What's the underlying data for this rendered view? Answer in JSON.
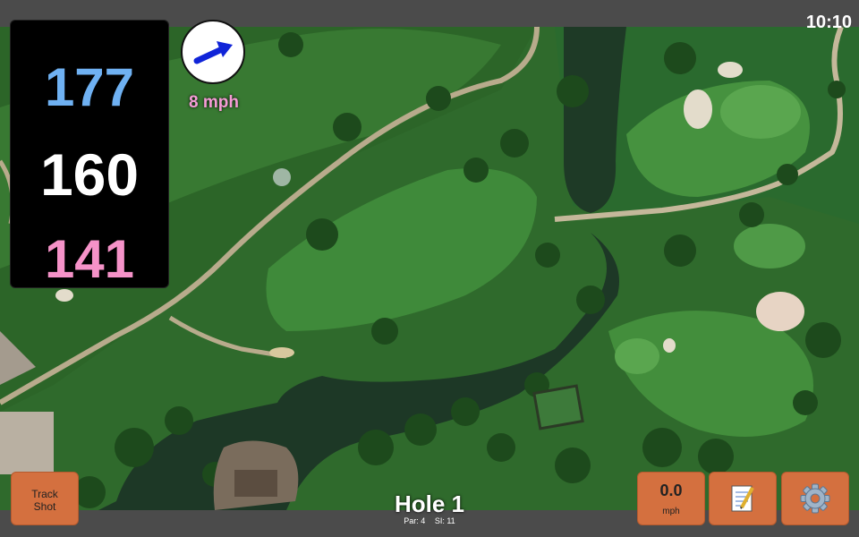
{
  "status_bar": {
    "time": "10:10"
  },
  "distances": {
    "back": "177",
    "middle": "160",
    "front": "141"
  },
  "wind": {
    "speed_label": "8 mph",
    "icon": "arrow-icon"
  },
  "buttons": {
    "track_shot_line1": "Track",
    "track_shot_line2": "Shot",
    "speed_value": "0.0",
    "speed_unit": "mph",
    "notes_icon": "notepad-icon",
    "settings_icon": "gear-icon"
  },
  "hole": {
    "title": "Hole 1",
    "par": "Par: 4",
    "si": "SI: 11"
  },
  "colors": {
    "distance_back": "#6fb1f2",
    "distance_middle": "#ffffff",
    "distance_front": "#f592c8",
    "wind_text": "#f59cd6",
    "button_fill": "#d4703f",
    "wind_arrow": "#1024d8"
  }
}
